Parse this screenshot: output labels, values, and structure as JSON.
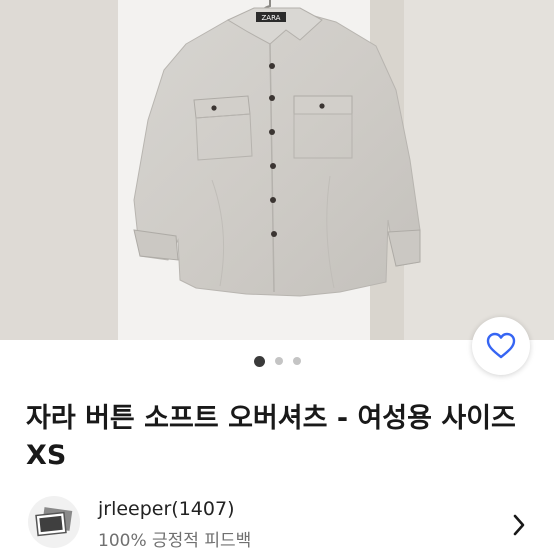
{
  "listing": {
    "title": "자라 버튼 소프트 오버셔츠 - 여성용 사이즈 XS",
    "image_count": 3,
    "active_image_index": 0,
    "brand_label": "ZARA"
  },
  "seller": {
    "name_with_count": "jrleeper(1407)",
    "feedback": "100% 긍정적 피드백"
  },
  "icons": {
    "wishlist": "heart-outline-icon",
    "seller_nav": "chevron-right-icon",
    "seller_avatar": "photo-placeholder-icon"
  },
  "colors": {
    "accent": "#3665f3",
    "title_text": "#191919",
    "secondary_text": "#707070"
  }
}
